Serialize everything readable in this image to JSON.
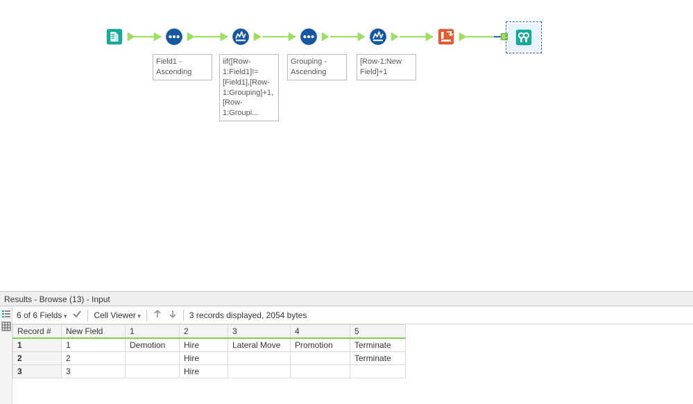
{
  "workflow": {
    "tools": [
      {
        "id": "input",
        "kind": "input-data",
        "color": "#16a99a"
      },
      {
        "id": "sort1",
        "kind": "sort",
        "color": "#1557a2",
        "label": "Field1 - Ascending"
      },
      {
        "id": "formula1",
        "kind": "multi-row",
        "color": "#1557a2",
        "label": "iif([Row-1:Field1]!=[Field1],[Row-1:Grouping]+1,[Row-1:Groupi..."
      },
      {
        "id": "sort2",
        "kind": "sort",
        "color": "#1557a2",
        "label": "Grouping - Ascending"
      },
      {
        "id": "formula2",
        "kind": "multi-row",
        "color": "#1557a2",
        "label": "[Row-1:New Field]+1"
      },
      {
        "id": "crosstab",
        "kind": "cross-tab",
        "color": "#e35c33"
      },
      {
        "id": "browse",
        "kind": "browse",
        "color": "#16a99a",
        "selected": true
      }
    ]
  },
  "results": {
    "panel_title": "Results - Browse (13) - Input",
    "fields_summary": "6 of 6 Fields",
    "cell_viewer_label": "Cell Viewer",
    "records_summary": "3 records displayed, 2054 bytes",
    "columns": [
      "Record #",
      "New Field",
      "1",
      "2",
      "3",
      "4",
      "5"
    ],
    "rows": [
      {
        "record": "1",
        "new_field": "1",
        "c1": "Demotion",
        "c2": "Hire",
        "c3": "Lateral Move",
        "c4": "Promotion",
        "c5": "Terminate"
      },
      {
        "record": "2",
        "new_field": "2",
        "c1": "",
        "c2": "Hire",
        "c3": "",
        "c4": "",
        "c5": "Terminate"
      },
      {
        "record": "3",
        "new_field": "3",
        "c1": "",
        "c2": "Hire",
        "c3": "",
        "c4": "",
        "c5": ""
      }
    ]
  }
}
